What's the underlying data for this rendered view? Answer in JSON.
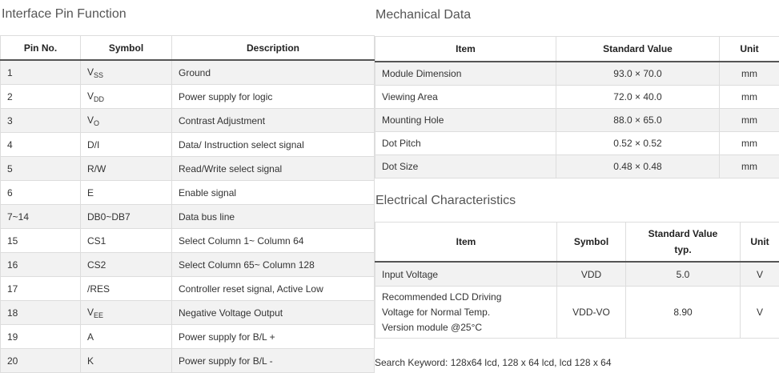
{
  "pin_section": {
    "title": "Interface Pin Function",
    "headers": [
      "Pin No.",
      "Symbol",
      "Description"
    ],
    "rows": [
      {
        "pin": "1",
        "symbol": "V",
        "symbol_sub": "SS",
        "description": "Ground"
      },
      {
        "pin": "2",
        "symbol": "V",
        "symbol_sub": "DD",
        "description": "Power supply for logic"
      },
      {
        "pin": "3",
        "symbol": "V",
        "symbol_sub": "O",
        "description": "Contrast Adjustment"
      },
      {
        "pin": "4",
        "symbol": "D/I",
        "symbol_sub": "",
        "description": "Data/ Instruction  select signal"
      },
      {
        "pin": "5",
        "symbol": "R/W",
        "symbol_sub": "",
        "description": "Read/Write select signal"
      },
      {
        "pin": "6",
        "symbol": "E",
        "symbol_sub": "",
        "description": "Enable signal"
      },
      {
        "pin": "7~14",
        "symbol": "DB0~DB7",
        "symbol_sub": "",
        "description": "Data bus line"
      },
      {
        "pin": "15",
        "symbol": "CS1",
        "symbol_sub": "",
        "description": "Select Column 1~ Column 64"
      },
      {
        "pin": "16",
        "symbol": "CS2",
        "symbol_sub": "",
        "description": "Select Column 65~ Column 128"
      },
      {
        "pin": "17",
        "symbol": "/RES",
        "symbol_sub": "",
        "description": "Controller reset signal, Active Low"
      },
      {
        "pin": "18",
        "symbol": "V",
        "symbol_sub": "EE",
        "description": "Negative Voltage Output"
      },
      {
        "pin": "19",
        "symbol": "A",
        "symbol_sub": "",
        "description": "Power supply for B/L +"
      },
      {
        "pin": "20",
        "symbol": "K",
        "symbol_sub": "",
        "description": "Power supply for B/L -"
      }
    ]
  },
  "mechanical_section": {
    "title": "Mechanical Data",
    "headers": [
      "Item",
      "Standard Value",
      "Unit"
    ],
    "rows": [
      {
        "item": "Module Dimension",
        "value": "93.0 × 70.0",
        "unit": "mm"
      },
      {
        "item": "Viewing Area",
        "value": "72.0 × 40.0",
        "unit": "mm"
      },
      {
        "item": "Mounting Hole",
        "value": "88.0 × 65.0",
        "unit": "mm"
      },
      {
        "item": "Dot Pitch",
        "value": "0.52 × 0.52",
        "unit": "mm"
      },
      {
        "item": "Dot Size",
        "value": "0.48 × 0.48",
        "unit": "mm"
      }
    ]
  },
  "electrical_section": {
    "title": "Electrical Characteristics",
    "headers": {
      "item": "Item",
      "symbol": "Symbol",
      "value_line1": "Standard Value",
      "value_line2": "typ.",
      "unit": "Unit"
    },
    "rows": [
      {
        "item_lines": [
          "Input Voltage"
        ],
        "symbol": "VDD",
        "value": "5.0",
        "unit": "V"
      },
      {
        "item_lines": [
          "Recommended LCD Driving",
          "Voltage for Normal Temp.",
          "Version module @25°C"
        ],
        "symbol": "VDD-VO",
        "value": "8.90",
        "unit": "V"
      }
    ]
  },
  "search_keyword": "Search Keyword: 128x64 lcd, 128 x 64 lcd, lcd 128 x 64",
  "colors": {
    "header_rule": "#555555",
    "stripe": "#f2f2f2",
    "border": "#dddddd"
  }
}
